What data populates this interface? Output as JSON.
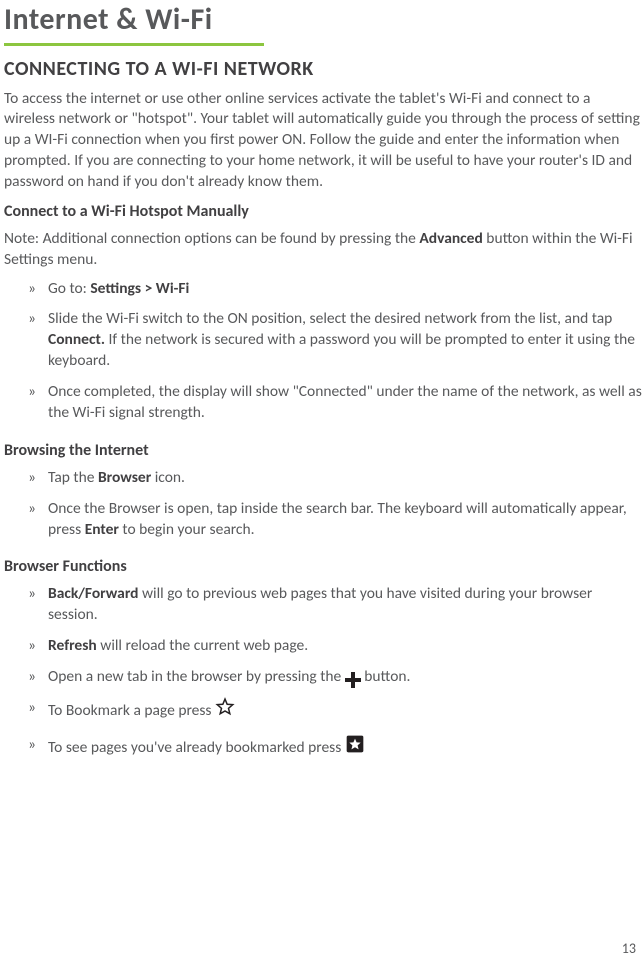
{
  "title": "Internet & Wi-Fi",
  "section": "CONNECTING TO A WI-FI NETWORK",
  "intro": "To access the internet or use other online services activate the tablet's Wi-Fi and connect to a wireless network or \"hotspot\". Your tablet will automatically guide you through the process of setting up a WI-Fi connection when you first power ON. Follow the guide and enter the information when prompted. If you are connecting to your home network, it will be useful to have your router's ID and password on hand if you don't already know them.",
  "sub1": "Connect to a Wi-Fi Hotspot Manually",
  "note_pre": "Note: Additional connection options can be found by pressing the ",
  "note_bold": "Advanced",
  "note_post": " button within the Wi-Fi Settings menu.",
  "connect": {
    "b1_pre": "Go to: ",
    "b1_bold": "Settings > Wi-Fi",
    "b2_pre": "Slide the Wi-Fi switch to the ON position, select the desired network from the list, and tap ",
    "b2_bold": "Connect.",
    "b2_post": " If the network is secured with a password you will be prompted to enter it using the keyboard.",
    "b3": "Once completed, the display will show \"Connected\" under the name of the network, as well as the Wi-Fi signal strength."
  },
  "sub2": "Browsing the Internet",
  "browse": {
    "b1_pre": "Tap the ",
    "b1_bold": "Browser",
    "b1_post": " icon.",
    "b2_pre": "Once the Browser is open, tap inside the search bar. The keyboard will automatically appear, press ",
    "b2_bold": "Enter",
    "b2_post": " to begin your search."
  },
  "sub3": "Browser Functions",
  "funcs": {
    "b1_bold": "Back/Forward",
    "b1_post": " will go to previous web pages that you have visited during your browser session.",
    "b2_bold": "Refresh",
    "b2_post": " will reload the current web page.",
    "b3_pre": "Open a new tab in the browser by pressing the ",
    "b3_post": " button.",
    "b4": "To Bookmark a page press ",
    "b5": "To see pages you've already bookmarked press "
  },
  "page_number": "13"
}
